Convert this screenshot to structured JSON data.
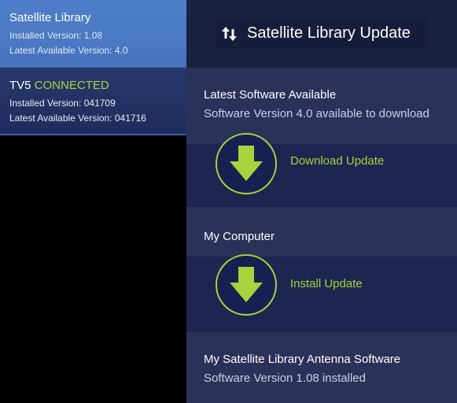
{
  "sidebar": {
    "devices": [
      {
        "name": "Satellite Library",
        "status": "",
        "installed_version": "Installed Version: 1.08",
        "latest_version": "Latest Available Version: 4.0"
      },
      {
        "name": "TV5",
        "status": "CONNECTED",
        "installed_version": "Installed Version: 041709",
        "latest_version": "Latest Available Version: 041716"
      }
    ]
  },
  "header": {
    "title": "Satellite Library Update",
    "icon": "sort-arrows-icon"
  },
  "latest": {
    "heading": "Latest Software Available",
    "subtitle": "Software Version 4.0 available to download"
  },
  "download": {
    "label": "Download Update",
    "icon": "download-arrow-icon"
  },
  "my_computer": {
    "heading": "My Computer"
  },
  "install": {
    "label": "Install Update",
    "icon": "install-arrow-icon"
  },
  "antenna": {
    "heading": "My Satellite Library Antenna Software",
    "subtitle": "Software Version 1.08 installed"
  },
  "colors": {
    "accent": "#a7d33c",
    "selected_device": "#4f7fca",
    "device_bg": "#28386b",
    "panel_bg": "#1b2448"
  }
}
